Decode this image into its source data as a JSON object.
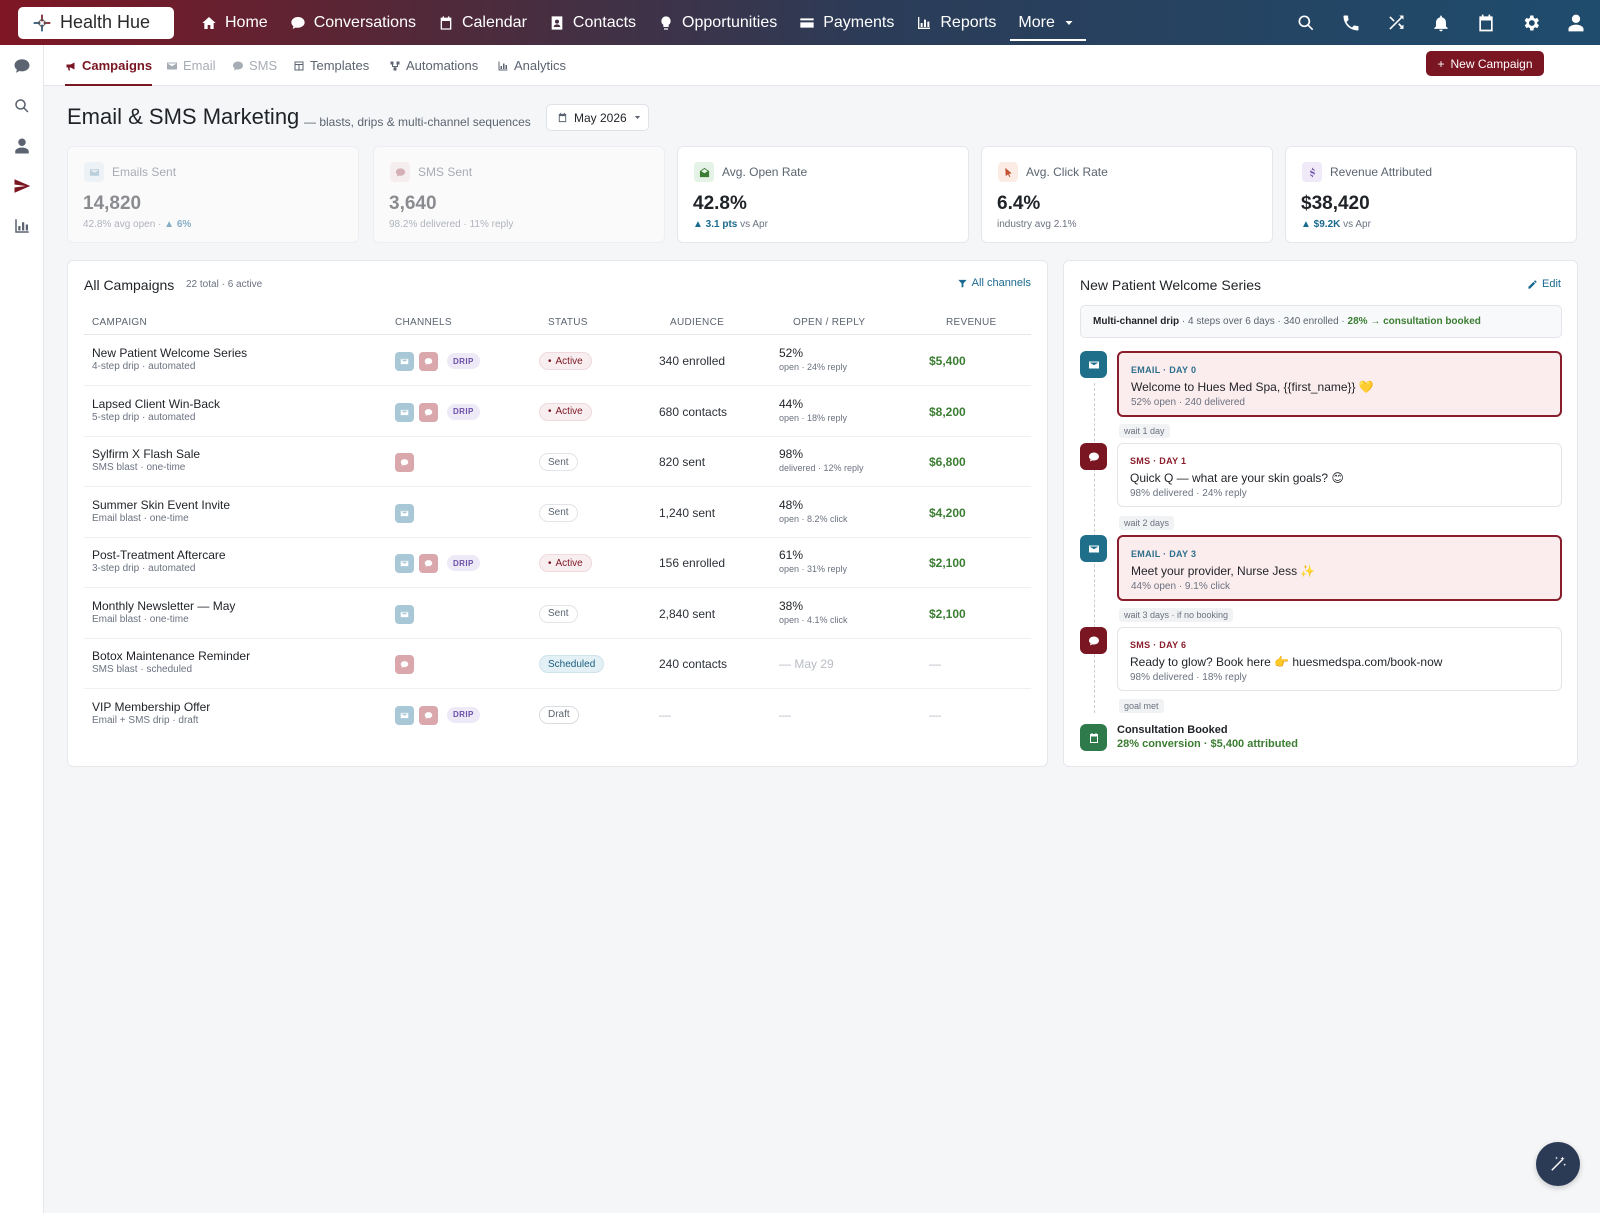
{
  "app": {
    "logo_text": "Health Hue"
  },
  "topnav": [
    {
      "label": "Home",
      "icon": "home-icon"
    },
    {
      "label": "Conversations",
      "icon": "chat-icon"
    },
    {
      "label": "Calendar",
      "icon": "calendar-icon"
    },
    {
      "label": "Contacts",
      "icon": "contact-card-icon"
    },
    {
      "label": "Opportunities",
      "icon": "lightbulb-icon"
    },
    {
      "label": "Payments",
      "icon": "credit-card-icon"
    },
    {
      "label": "Reports",
      "icon": "bar-chart-icon"
    },
    {
      "label": "More",
      "icon": "chevron-down-icon"
    }
  ],
  "topright_icons": [
    "search-icon",
    "phone-icon",
    "shuffle-icon",
    "bell-icon",
    "calendar-icon",
    "gear-icon",
    "user-icon"
  ],
  "subnav": {
    "tabs": [
      {
        "label": "Campaigns",
        "state": "active",
        "icon": "megaphone-icon"
      },
      {
        "label": "Email",
        "state": "dim",
        "icon": "envelope-icon"
      },
      {
        "label": "SMS",
        "state": "dim",
        "icon": "chat-icon"
      },
      {
        "label": "Templates",
        "state": "normal",
        "icon": "template-icon"
      },
      {
        "label": "Automations",
        "state": "normal",
        "icon": "flow-icon"
      },
      {
        "label": "Analytics",
        "state": "normal",
        "icon": "bar-chart-icon"
      }
    ],
    "new_campaign_label": "New Campaign"
  },
  "page": {
    "title": "Email & SMS Marketing",
    "subtitle": "— blasts, drips & multi-channel sequences",
    "month": "May 2026"
  },
  "kpis": [
    {
      "label": "Emails Sent",
      "value": "14,820",
      "sub_pre": "42.8% avg open · ",
      "sub_b": "▲ 6%",
      "sub_post": "",
      "dim": true,
      "icon": "envelope-icon",
      "bg": "#e6f0f5",
      "fg": "#7fa9bf"
    },
    {
      "label": "SMS Sent",
      "value": "3,640",
      "sub_pre": "98.2% delivered · 11% reply",
      "sub_b": "",
      "sub_post": "",
      "dim": true,
      "icon": "chat-icon",
      "bg": "#f7e6e8",
      "fg": "#b56b75"
    },
    {
      "label": "Avg. Open Rate",
      "value": "42.8%",
      "sub_pre": "",
      "sub_b": "▲ 3.1 pts",
      "sub_post": " vs Apr",
      "dim": false,
      "icon": "envelope-open-icon",
      "bg": "#e5f2e6",
      "fg": "#3b7d32"
    },
    {
      "label": "Avg. Click Rate",
      "value": "6.4%",
      "sub_pre": "industry avg 2.1%",
      "sub_b": "",
      "sub_post": "",
      "dim": false,
      "icon": "cursor-icon",
      "bg": "#fbece6",
      "fg": "#c0532f"
    },
    {
      "label": "Revenue Attributed",
      "value": "$38,420",
      "sub_pre": "",
      "sub_b": "▲ $9.2K",
      "sub_post": " vs Apr",
      "dim": false,
      "icon": "dollar-icon",
      "bg": "#efe9f8",
      "fg": "#6b4fa8"
    }
  ],
  "campaigns": {
    "title": "All Campaigns",
    "meta": "22 total · 6 active",
    "filter_label": "All channels",
    "columns": [
      "CAMPAIGN",
      "CHANNELS",
      "STATUS",
      "AUDIENCE",
      "OPEN / REPLY",
      "REVENUE"
    ],
    "rows": [
      {
        "name": "New Patient Welcome Series",
        "sub": "4-step drip · automated",
        "email": true,
        "sms": true,
        "drip": true,
        "status": "Active",
        "status_kind": "active",
        "audience": "340 enrolled",
        "open": "52%",
        "open_sub": "open · 24% reply",
        "revenue": "$5,400",
        "open_muted": false,
        "rev_muted": false
      },
      {
        "name": "Lapsed Client Win-Back",
        "sub": "5-step drip · automated",
        "email": true,
        "sms": true,
        "drip": true,
        "status": "Active",
        "status_kind": "active",
        "audience": "680 contacts",
        "open": "44%",
        "open_sub": "open · 18% reply",
        "revenue": "$8,200",
        "open_muted": false,
        "rev_muted": false
      },
      {
        "name": "Sylfirm X Flash Sale",
        "sub": "SMS blast · one-time",
        "email": false,
        "sms": true,
        "drip": false,
        "status": "Sent",
        "status_kind": "sent",
        "audience": "820 sent",
        "open": "98%",
        "open_sub": "delivered · 12% reply",
        "revenue": "$6,800",
        "open_muted": false,
        "rev_muted": false
      },
      {
        "name": "Summer Skin Event Invite",
        "sub": "Email blast · one-time",
        "email": true,
        "sms": false,
        "drip": false,
        "status": "Sent",
        "status_kind": "sent",
        "audience": "1,240 sent",
        "open": "48%",
        "open_sub": "open · 8.2% click",
        "revenue": "$4,200",
        "open_muted": false,
        "rev_muted": false
      },
      {
        "name": "Post-Treatment Aftercare",
        "sub": "3-step drip · automated",
        "email": true,
        "sms": true,
        "drip": true,
        "status": "Active",
        "status_kind": "active",
        "audience": "156 enrolled",
        "open": "61%",
        "open_sub": "open · 31% reply",
        "revenue": "$2,100",
        "open_muted": false,
        "rev_muted": false
      },
      {
        "name": "Monthly Newsletter — May",
        "sub": "Email blast · one-time",
        "email": true,
        "sms": false,
        "drip": false,
        "status": "Sent",
        "status_kind": "sent",
        "audience": "2,840 sent",
        "open": "38%",
        "open_sub": "open · 4.1% click",
        "revenue": "$2,100",
        "open_muted": false,
        "rev_muted": false
      },
      {
        "name": "Botox Maintenance Reminder",
        "sub": "SMS blast · scheduled",
        "email": false,
        "sms": true,
        "drip": false,
        "status": "Scheduled",
        "status_kind": "sched",
        "audience": "240 contacts",
        "open": "— May 29",
        "open_sub": "",
        "revenue": "—",
        "open_muted": true,
        "rev_muted": true
      },
      {
        "name": "VIP Membership Offer",
        "sub": "Email + SMS drip · draft",
        "email": true,
        "sms": true,
        "drip": true,
        "status": "Draft",
        "status_kind": "draft",
        "audience": "—",
        "open": "—",
        "open_sub": "",
        "revenue": "—",
        "open_muted": true,
        "rev_muted": true,
        "aud_muted": true
      }
    ],
    "drip_label": "DRIP"
  },
  "sequence": {
    "title": "New Patient Welcome Series",
    "edit_label": "Edit",
    "summary_b": "Multi-channel drip",
    "summary_mid": " · 4 steps over 6 days · 340 enrolled · ",
    "summary_g": "28% → consultation booked",
    "steps": [
      {
        "kind": "EMAIL · DAY 0",
        "channel": "email",
        "title": "Welcome to Hues Med Spa, {{first_name}} 💛",
        "stats": "52% open · 240 delivered",
        "highlight": true
      },
      {
        "kind": "SMS · DAY 1",
        "channel": "sms",
        "title": "Quick Q — what are your skin goals? 😊",
        "stats": "98% delivered · 24% reply",
        "highlight": false
      },
      {
        "kind": "EMAIL · DAY 3",
        "channel": "email",
        "title": "Meet your provider, Nurse Jess ✨",
        "stats": "44% open · 9.1% click",
        "highlight": true
      },
      {
        "kind": "SMS · DAY 6",
        "channel": "sms",
        "title": "Ready to glow? Book here 👉 huesmedspa.com/book-now",
        "stats": "98% delivered · 18% reply",
        "highlight": false
      }
    ],
    "waits": [
      "wait 1 day",
      "wait 2 days",
      "wait 3 days · if no booking",
      "goal met"
    ],
    "goal_title": "Consultation Booked",
    "goal_sub": "28% conversion · $5,400 attributed"
  },
  "colors": {
    "brand": "#7a1522",
    "email_step": "#1f6f8b",
    "sms_step": "#7a1522",
    "goal": "#2f7a4a",
    "positive": "#3b7d32"
  }
}
